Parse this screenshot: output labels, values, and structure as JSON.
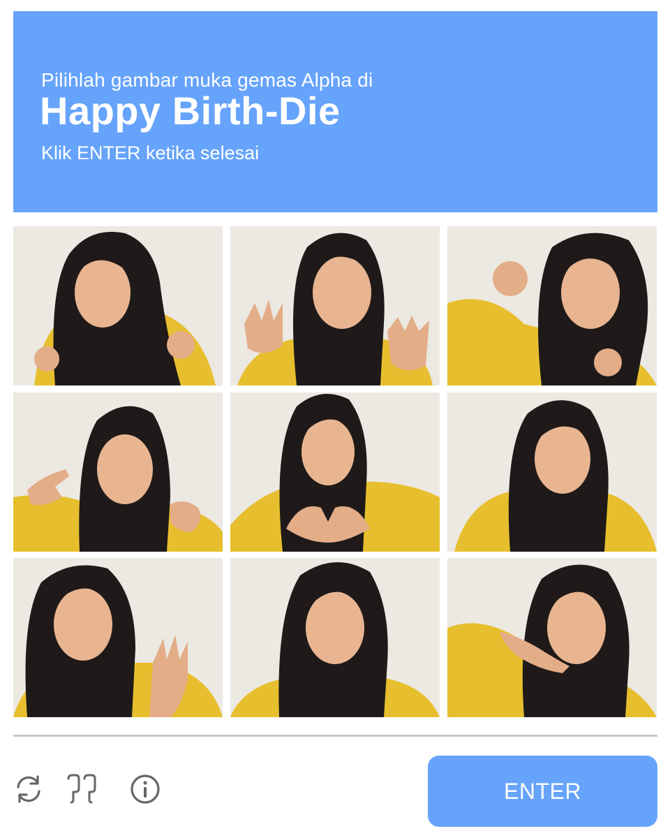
{
  "header": {
    "line1": "Pilihlah gambar muka gemas Alpha di",
    "title": "Happy Birth-Die",
    "line3": "Klik ENTER ketika selesai",
    "background_color": "#66a3fb"
  },
  "grid": {
    "rows": 3,
    "columns": 3,
    "tiles": [
      {
        "pose": "playful-frown-fists"
      },
      {
        "pose": "claw-hands"
      },
      {
        "pose": "big-smile-fists-up"
      },
      {
        "pose": "pointing-fingers"
      },
      {
        "pose": "heart-hands"
      },
      {
        "pose": "soft-smile"
      },
      {
        "pose": "waving-hand"
      },
      {
        "pose": "pouting-face"
      },
      {
        "pose": "hand-under-chin"
      }
    ]
  },
  "footer": {
    "icons": [
      "refresh-icon",
      "audio-icon",
      "info-icon"
    ],
    "enter_label": "ENTER",
    "enter_color": "#66a3fb"
  }
}
